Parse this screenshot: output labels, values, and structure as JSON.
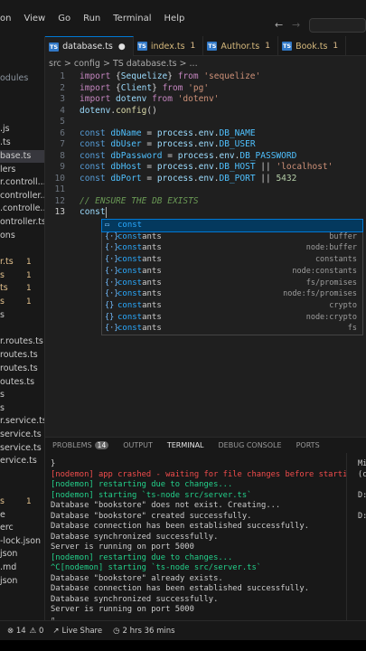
{
  "menu": {
    "items": [
      "on",
      "View",
      "Go",
      "Run",
      "Terminal",
      "Help"
    ]
  },
  "tabs": [
    {
      "label": "database.ts",
      "badge": "●"
    },
    {
      "label": "index.ts",
      "badge": "1"
    },
    {
      "label": "Author.ts",
      "badge": "1"
    },
    {
      "label": "Book.ts",
      "badge": "1"
    }
  ],
  "breadcrumb": "src > config > TS database.ts > ...",
  "sidebar": {
    "items": [
      {
        "label": "odules",
        "color": "#8b949e"
      },
      {
        "label": "",
        "color": "#ccc"
      },
      {
        "label": ".js",
        "color": "#ccc"
      },
      {
        "label": ".ts",
        "color": "#ccc"
      },
      {
        "label": "base.ts",
        "color": "#ccc"
      },
      {
        "label": "lers",
        "color": "#ccc"
      },
      {
        "label": "r.controll...",
        "color": "#ccc"
      },
      {
        "label": "controller...",
        "color": "#ccc"
      },
      {
        "label": ".controlle...",
        "color": "#ccc"
      },
      {
        "label": "ontroller.ts",
        "color": "#ccc"
      },
      {
        "label": "ons",
        "color": "#ccc"
      },
      {
        "label": "",
        "color": "#ccc"
      },
      {
        "label": "r.ts",
        "color": "#e2c08d"
      },
      {
        "label": "s",
        "color": "#e2c08d"
      },
      {
        "label": "ts",
        "color": "#e2c08d"
      },
      {
        "label": "s",
        "color": "#e2c08d"
      },
      {
        "label": "s",
        "color": "#ccc"
      },
      {
        "label": "",
        "color": "#ccc"
      },
      {
        "label": "r.routes.ts",
        "color": "#ccc"
      },
      {
        "label": "routes.ts",
        "color": "#ccc"
      },
      {
        "label": "routes.ts",
        "color": "#ccc"
      },
      {
        "label": "outes.ts",
        "color": "#ccc"
      },
      {
        "label": "s",
        "color": "#ccc"
      },
      {
        "label": "s",
        "color": "#ccc"
      },
      {
        "label": "r.service.ts",
        "color": "#ccc"
      },
      {
        "label": "service.ts",
        "color": "#ccc"
      },
      {
        "label": "service.ts",
        "color": "#ccc"
      },
      {
        "label": "ervice.ts",
        "color": "#ccc"
      },
      {
        "label": "",
        "color": "#ccc"
      },
      {
        "label": "",
        "color": "#ccc"
      },
      {
        "label": "s",
        "color": "#e2c08d"
      },
      {
        "label": "e",
        "color": "#ccc"
      },
      {
        "label": "erc",
        "color": "#ccc"
      },
      {
        "label": "-lock.json",
        "color": "#ccc"
      },
      {
        "label": "json",
        "color": "#ccc"
      },
      {
        "label": ".md",
        "color": "#ccc"
      },
      {
        "label": "json",
        "color": "#ccc"
      }
    ],
    "badges": [
      {
        "row": 12,
        "text": "1"
      },
      {
        "row": 13,
        "text": "1"
      },
      {
        "row": 14,
        "text": "1"
      },
      {
        "row": 15,
        "text": "1"
      },
      {
        "row": 30,
        "text": "1"
      }
    ]
  },
  "code": {
    "lines": [
      [
        [
          "kw",
          "import "
        ],
        [
          "punc",
          "{"
        ],
        [
          "var",
          "Sequelize"
        ],
        [
          "punc",
          "} "
        ],
        [
          "kw",
          "from "
        ],
        [
          "str",
          "'sequelize'"
        ]
      ],
      [
        [
          "kw",
          "import "
        ],
        [
          "punc",
          "{"
        ],
        [
          "var",
          "Client"
        ],
        [
          "punc",
          "} "
        ],
        [
          "kw",
          "from "
        ],
        [
          "str",
          "'pg'"
        ]
      ],
      [
        [
          "kw",
          "import "
        ],
        [
          "var",
          "dotenv "
        ],
        [
          "kw",
          "from "
        ],
        [
          "str",
          "'dotenv'"
        ]
      ],
      [
        [
          "var",
          "dotenv"
        ],
        [
          "punc",
          "."
        ],
        [
          "fn",
          "config"
        ],
        [
          "punc",
          "()"
        ]
      ],
      [],
      [
        [
          "bl",
          "const "
        ],
        [
          "prop",
          "dbName"
        ],
        [
          "punc",
          " = "
        ],
        [
          "var",
          "process"
        ],
        [
          "punc",
          "."
        ],
        [
          "var",
          "env"
        ],
        [
          "punc",
          "."
        ],
        [
          "prop",
          "DB_NAME"
        ]
      ],
      [
        [
          "bl",
          "const "
        ],
        [
          "prop",
          "dbUser"
        ],
        [
          "punc",
          " = "
        ],
        [
          "var",
          "process"
        ],
        [
          "punc",
          "."
        ],
        [
          "var",
          "env"
        ],
        [
          "punc",
          "."
        ],
        [
          "prop",
          "DB_USER"
        ]
      ],
      [
        [
          "bl",
          "const "
        ],
        [
          "prop",
          "dbPassword"
        ],
        [
          "punc",
          " = "
        ],
        [
          "var",
          "process"
        ],
        [
          "punc",
          "."
        ],
        [
          "var",
          "env"
        ],
        [
          "punc",
          "."
        ],
        [
          "prop",
          "DB_PASSWORD"
        ]
      ],
      [
        [
          "bl",
          "const "
        ],
        [
          "prop",
          "dbHost"
        ],
        [
          "punc",
          " = "
        ],
        [
          "var",
          "process"
        ],
        [
          "punc",
          "."
        ],
        [
          "var",
          "env"
        ],
        [
          "punc",
          "."
        ],
        [
          "prop",
          "DB_HOST"
        ],
        [
          "punc",
          " || "
        ],
        [
          "str",
          "'localhost'"
        ]
      ],
      [
        [
          "bl",
          "const "
        ],
        [
          "prop",
          "dbPort"
        ],
        [
          "punc",
          " = "
        ],
        [
          "var",
          "process"
        ],
        [
          "punc",
          "."
        ],
        [
          "var",
          "env"
        ],
        [
          "punc",
          "."
        ],
        [
          "prop",
          "DB_PORT"
        ],
        [
          "punc",
          " || "
        ],
        [
          "num",
          "5432"
        ]
      ],
      [],
      [
        [
          "cmt",
          "// ENSURE THE DB EXISTS"
        ]
      ],
      [
        [
          "var",
          "const"
        ]
      ]
    ]
  },
  "suggestions": [
    {
      "icon": "▭",
      "label": "const",
      "detail": "",
      "sel": true
    },
    {
      "icon": "{·}",
      "label": "constants",
      "detail": "buffer"
    },
    {
      "icon": "{·}",
      "label": "constants",
      "detail": "node:buffer"
    },
    {
      "icon": "{·}",
      "label": "constants",
      "detail": "constants"
    },
    {
      "icon": "{·}",
      "label": "constants",
      "detail": "node:constants"
    },
    {
      "icon": "{·}",
      "label": "constants",
      "detail": "fs/promises"
    },
    {
      "icon": "{·}",
      "label": "constants",
      "detail": "node:fs/promises"
    },
    {
      "icon": "{}",
      "label": "constants",
      "detail": "crypto"
    },
    {
      "icon": "{}",
      "label": "constants",
      "detail": "node:crypto"
    },
    {
      "icon": "{·}",
      "label": "constants",
      "detail": "fs"
    }
  ],
  "panel": {
    "tabs": [
      "PROBLEMS",
      "OUTPUT",
      "TERMINAL",
      "DEBUG CONSOLE",
      "PORTS"
    ],
    "problems_count": "14",
    "active": "TERMINAL"
  },
  "terminal": {
    "lines": [
      {
        "t": "}",
        "c": ""
      },
      {
        "t": "[nodemon] app crashed - waiting for file changes before starting...",
        "c": "r"
      },
      {
        "t": "[nodemon] restarting due to changes...",
        "c": "g"
      },
      {
        "t": "[nodemon] starting `ts-node src/server.ts`",
        "c": "g"
      },
      {
        "t": "Database \"bookstore\" does not exist. Creating...",
        "c": ""
      },
      {
        "t": "Database \"bookstore\" created successfully.",
        "c": ""
      },
      {
        "t": "Database connection has been established successfully.",
        "c": ""
      },
      {
        "t": "Database synchronized successfully.",
        "c": ""
      },
      {
        "t": "Server is running on port 5000",
        "c": ""
      },
      {
        "t": "[nodemon] restarting due to changes...",
        "c": "g"
      },
      {
        "t": "^C[nodemon] starting `ts-node src/server.ts`",
        "c": "g"
      },
      {
        "t": "Database \"bookstore\" already exists.",
        "c": ""
      },
      {
        "t": "Database connection has been established successfully.",
        "c": ""
      },
      {
        "t": "Database synchronized successfully.",
        "c": ""
      },
      {
        "t": "Server is running on port 5000",
        "c": ""
      },
      {
        "t": "▯",
        "c": ""
      }
    ]
  },
  "side_terminal": [
    "Mi",
    "(c",
    "",
    "D:",
    "",
    "D:"
  ],
  "status": {
    "errors": "⊗ 14",
    "warnings": "⚠ 0",
    "liveshare": "Live Share",
    "time": "2 hrs 36 mins"
  }
}
